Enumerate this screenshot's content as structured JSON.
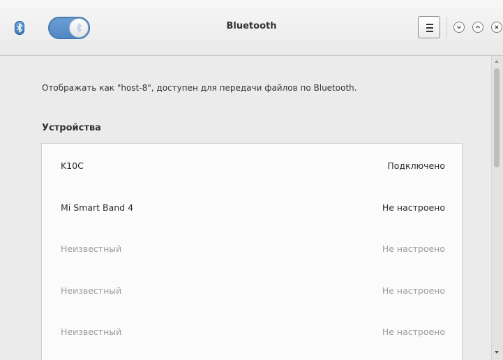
{
  "header": {
    "title": "Bluetooth",
    "bluetooth_enabled": true,
    "accent": "#5a8fcb"
  },
  "main": {
    "info_text": "Отображать как \"host-8\", доступен для передачи файлов по Bluetooth.",
    "devices_title": "Устройства",
    "devices": [
      {
        "name": "K10C",
        "status": "Подключено"
      },
      {
        "name": "Mi Smart Band 4",
        "status": "Не настроено"
      },
      {
        "name": "Неизвестный",
        "status": "Не настроено"
      },
      {
        "name": "Неизвестный",
        "status": "Не настроено"
      },
      {
        "name": "Неизвестный",
        "status": "Не настроено"
      }
    ]
  },
  "icons": {
    "app": "bluetooth-icon",
    "menu": "hamburger-menu-icon",
    "minimize": "chevron-down-icon",
    "maximize": "chevron-up-icon",
    "close": "close-icon"
  }
}
